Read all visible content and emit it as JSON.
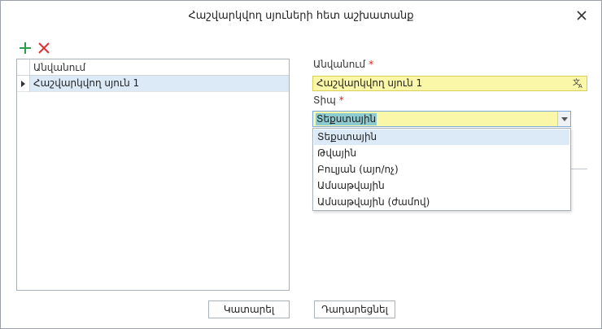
{
  "dialog": {
    "title": "Հաշվարկվող սյուների հետ աշխատանք"
  },
  "grid": {
    "header": "Անվանում",
    "rows": [
      {
        "name": "Հաշվարկվող սյուն 1"
      }
    ]
  },
  "form": {
    "name_label": "Անվանում",
    "name_value": "Հաշվարկվող սյուն 1",
    "type_label": "Տիպ",
    "required_mark": "*",
    "type_value": "Տեքստային",
    "type_options": [
      "Տեքստային",
      "Թվային",
      "Բուլյան (այո/ոչ)",
      "Ամսաթվային",
      "Ամսաթվային (ժամով)"
    ]
  },
  "buttons": {
    "ok": "Կատարել",
    "cancel": "Դադարեցնել"
  },
  "colors": {
    "required": "#e02020",
    "add_icon": "#2a9d4a",
    "delete_icon": "#e03030",
    "field_bg": "#fbf7a8",
    "selection": "#dce9f7"
  },
  "icons": {
    "add": "plus-icon",
    "delete": "x-icon",
    "close": "close-icon",
    "translate": "translate-icon"
  }
}
